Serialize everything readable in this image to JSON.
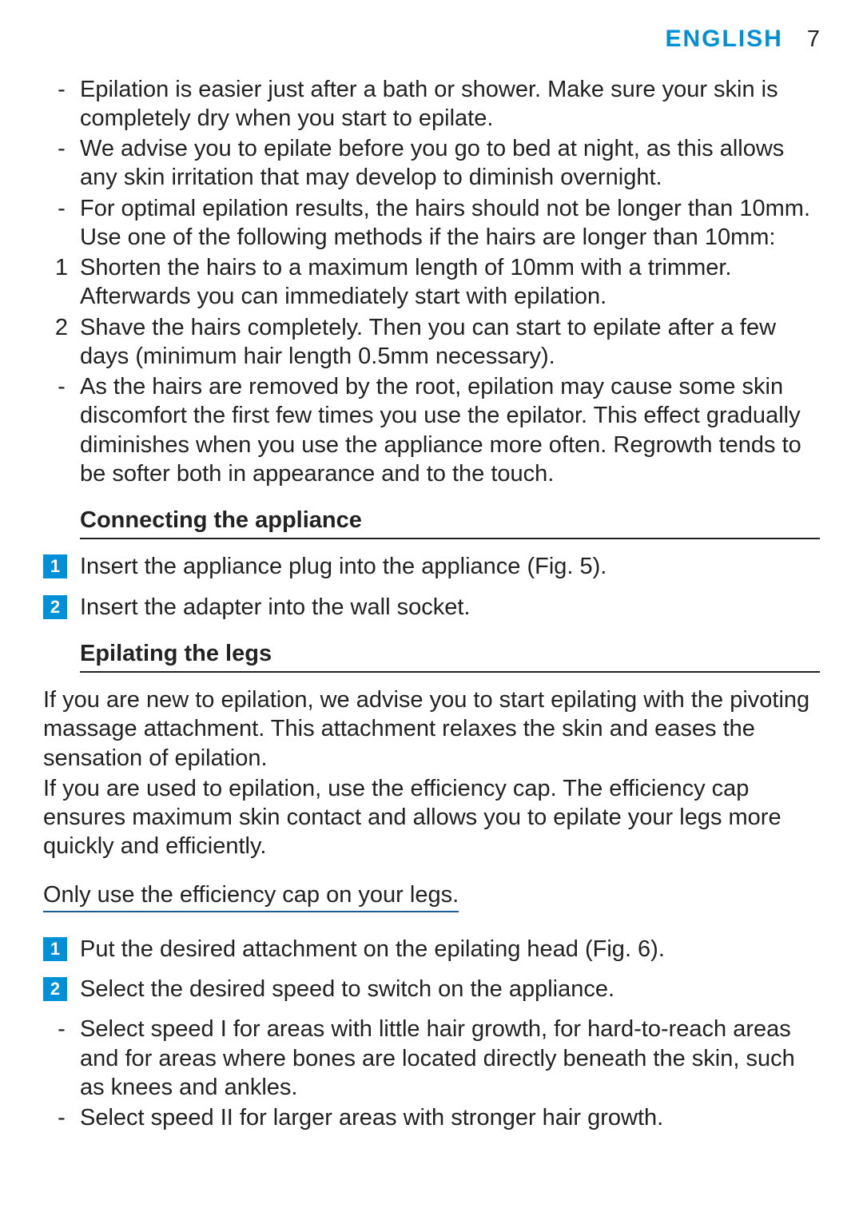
{
  "header": {
    "language": "ENGLISH",
    "page_number": "7"
  },
  "intro_items": [
    {
      "marker": "-",
      "text": "Epilation is easier just after a bath or shower. Make sure your skin is completely dry when you start to epilate."
    },
    {
      "marker": "-",
      "text": "We advise you to epilate before you go to bed at night, as this allows any skin irritation that may develop to diminish overnight."
    },
    {
      "marker": "-",
      "text": "For optimal epilation results, the hairs should not be longer than 10mm. Use one of the following methods if the hairs are longer than 10mm:"
    },
    {
      "marker": "1",
      "text": "Shorten the hairs to a maximum length of 10mm with a trimmer. Afterwards you can immediately start with epilation."
    },
    {
      "marker": "2",
      "text": "Shave the hairs completely. Then you can start to epilate after a few days (minimum hair length 0.5mm necessary)."
    },
    {
      "marker": "-",
      "text": "As the hairs are removed by the root, epilation may cause some skin discomfort the first few times you use the epilator. This effect gradually diminishes when you use the appliance more often. Regrowth tends to be softer both in appearance and to the touch."
    }
  ],
  "section_connecting": {
    "title": "Connecting the appliance",
    "steps": [
      {
        "num": "1",
        "text": "Insert the appliance plug into the appliance (Fig. 5)."
      },
      {
        "num": "2",
        "text": "Insert the adapter into the wall socket."
      }
    ]
  },
  "section_epilating": {
    "title": "Epilating the legs",
    "paragraphs": [
      "If you are new to epilation, we advise you to start epilating with the pivoting massage attachment. This attachment relaxes the skin and eases the sensation of epilation.",
      "If you are used to epilation, use the efficiency cap. The efficiency cap ensures maximum skin contact and allows you to epilate your legs more quickly and efficiently."
    ],
    "note": "Only use the efficiency cap on your legs.",
    "steps": [
      {
        "num": "1",
        "text": "Put the desired attachment on the epilating head (Fig. 6)."
      },
      {
        "num": "2",
        "text": "Select the desired speed to switch on the appliance."
      }
    ],
    "sub_items": [
      {
        "marker": "-",
        "text": "Select speed I for areas with little hair growth, for hard-to-reach areas and for areas where bones are located directly beneath the skin, such as knees and ankles."
      },
      {
        "marker": "-",
        "text": "Select speed II for larger areas with stronger hair growth."
      }
    ]
  }
}
